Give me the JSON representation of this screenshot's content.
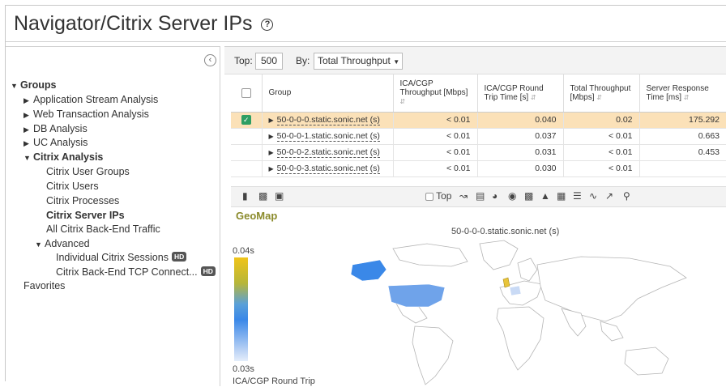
{
  "page": {
    "title": "Navigator/Citrix Server IPs"
  },
  "sidebar": {
    "items": [
      {
        "label": "Groups",
        "expanded": true,
        "bold": true
      },
      {
        "label": "Application Stream Analysis"
      },
      {
        "label": "Web Transaction Analysis"
      },
      {
        "label": "DB Analysis"
      },
      {
        "label": "UC Analysis"
      },
      {
        "label": "Citrix Analysis",
        "expanded": true,
        "bold": true
      },
      {
        "label": "Citrix User Groups"
      },
      {
        "label": "Citrix Users"
      },
      {
        "label": "Citrix Processes"
      },
      {
        "label": "Citrix Server IPs",
        "bold": true
      },
      {
        "label": "All Citrix Back-End Traffic"
      },
      {
        "label": "Advanced",
        "expanded": true
      },
      {
        "label": "Individual Citrix Sessions",
        "badge": "HD"
      },
      {
        "label": "Citrix Back-End TCP Connect...",
        "badge": "HD"
      },
      {
        "label": "Favorites"
      }
    ]
  },
  "controls": {
    "top_label": "Top:",
    "top_value": "500",
    "by_label": "By:",
    "by_value": "Total Throughput"
  },
  "table": {
    "columns": [
      "Group",
      "ICA/CGP Throughput [Mbps]",
      "ICA/CGP Round Trip Time [s]",
      "Total Throughput [Mbps]",
      "Server Response Time [ms]"
    ],
    "rows": [
      {
        "group": "50-0-0-0.static.sonic.net (s)",
        "ica_thr": "< 0.01",
        "rtt": "0.040",
        "total": "0.02",
        "srt": "175.292",
        "selected": true
      },
      {
        "group": "50-0-0-1.static.sonic.net (s)",
        "ica_thr": "< 0.01",
        "rtt": "0.037",
        "total": "< 0.01",
        "srt": "0.663"
      },
      {
        "group": "50-0-0-2.static.sonic.net (s)",
        "ica_thr": "< 0.01",
        "rtt": "0.031",
        "total": "< 0.01",
        "srt": "0.453"
      },
      {
        "group": "50-0-0-3.static.sonic.net (s)",
        "ica_thr": "< 0.01",
        "rtt": "0.030",
        "total": "< 0.01",
        "srt": ""
      }
    ]
  },
  "chart_toolbar": {
    "top_label": "Top"
  },
  "geomap": {
    "title": "GeoMap",
    "subtitle": "50-0-0-0.static.sonic.net (s)",
    "legend_max": "0.04s",
    "legend_min": "0.03s",
    "legend_caption": "ICA/CGP Round Trip"
  },
  "colors": {
    "selected_row": "#fbe1b8",
    "checkbox": "#2e9e63",
    "geo_title": "#8a8a2a",
    "map_land": "#ffffff",
    "map_highlight_us": "#6fa3ea",
    "map_highlight_canada": "#3a88e8",
    "map_highlight_uk": "#e8c43a"
  }
}
